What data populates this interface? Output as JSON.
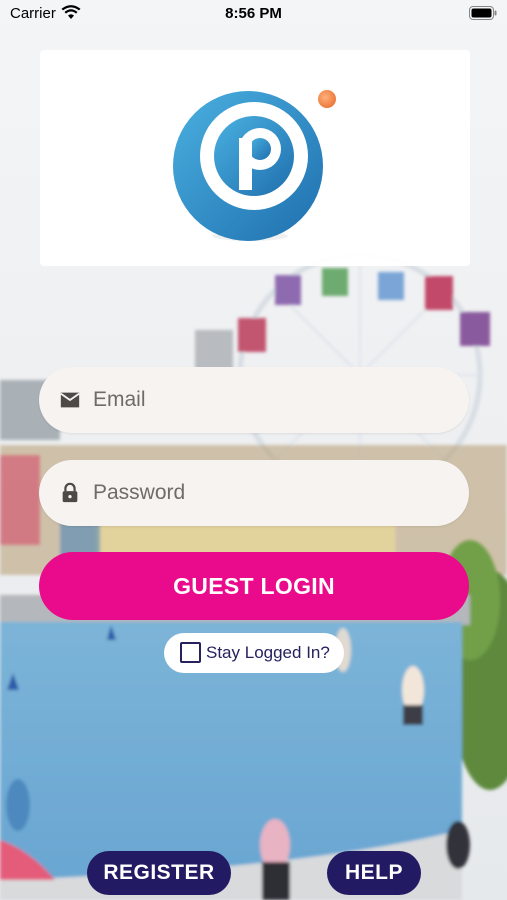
{
  "status_bar": {
    "carrier": "Carrier",
    "time": "8:56 PM"
  },
  "login": {
    "email_placeholder": "Email",
    "password_placeholder": "Password",
    "guest_login_label": "GUEST LOGIN",
    "stay_logged_in_label": "Stay Logged In?",
    "stay_logged_in_checked": false
  },
  "footer": {
    "register_label": "REGISTER",
    "help_label": "HELP"
  },
  "colors": {
    "guest_button": "#ea0a8c",
    "footer_buttons": "#221a62",
    "logo_blue": "#2a86c4",
    "logo_dot": "#f0905a"
  },
  "icons": {
    "email": "envelope-icon",
    "password": "lock-icon",
    "wifi": "wifi-icon",
    "battery": "battery-icon"
  }
}
